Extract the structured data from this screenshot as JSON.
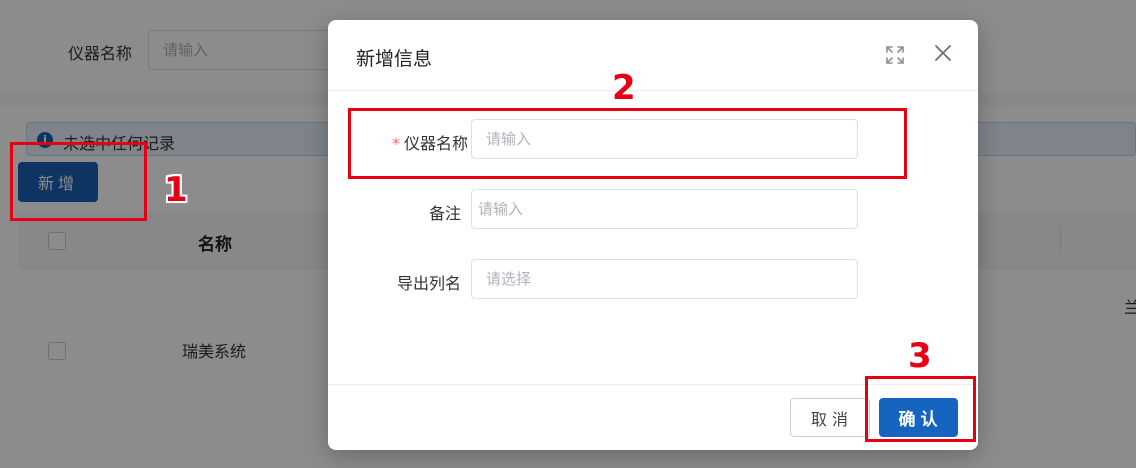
{
  "background": {
    "search": {
      "label": "仪器名称",
      "placeholder": "请输入"
    },
    "alert": {
      "text": "未选中任何记录",
      "icon": "info-icon"
    },
    "add_button": "新增",
    "table": {
      "headers": [
        "名称"
      ],
      "rows": [
        {
          "name": "瑞美系统",
          "partial": "兰"
        }
      ]
    }
  },
  "dialog": {
    "title": "新增信息",
    "icons": {
      "fullscreen": "fullscreen-icon",
      "close": "close-icon"
    },
    "fields": [
      {
        "label": "仪器名称",
        "required": true,
        "placeholder": "请输入"
      },
      {
        "label": "备注",
        "required": false,
        "placeholder": "请输入"
      },
      {
        "label": "导出列名",
        "required": false,
        "placeholder": "请选择"
      }
    ],
    "required_mark": "*",
    "cancel_label": "取消",
    "confirm_label": "确认"
  },
  "annotations": [
    {
      "number": "1"
    },
    {
      "number": "2"
    },
    {
      "number": "3"
    }
  ],
  "colors": {
    "primary": "#1565c0",
    "annotation": "#e60012",
    "required": "#f56c6c",
    "overlay": "rgba(0,0,0,0.45)"
  }
}
